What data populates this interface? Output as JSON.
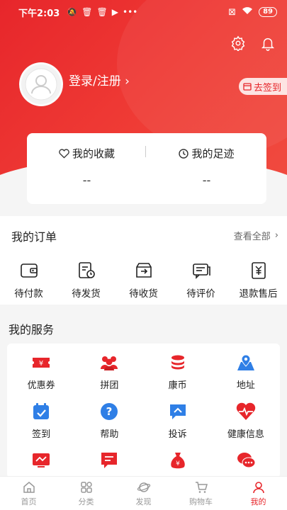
{
  "status": {
    "time": "下午2:03",
    "battery": "89"
  },
  "profile": {
    "login": "登录/注册",
    "checkin": "去签到"
  },
  "card": {
    "favorites": {
      "label": "我的收藏",
      "value": "--"
    },
    "footprints": {
      "label": "我的足迹",
      "value": "--"
    }
  },
  "orders": {
    "title": "我的订单",
    "more": "查看全部",
    "items": [
      {
        "label": "待付款",
        "icon": "wallet-icon"
      },
      {
        "label": "待发货",
        "icon": "clock-doc-icon"
      },
      {
        "label": "待收货",
        "icon": "box-icon"
      },
      {
        "label": "待评价",
        "icon": "comment-icon"
      },
      {
        "label": "退款售后",
        "icon": "refund-icon"
      }
    ]
  },
  "services": {
    "title": "我的服务",
    "items": [
      {
        "label": "优惠券",
        "icon": "coupon-icon"
      },
      {
        "label": "拼团",
        "icon": "group-icon"
      },
      {
        "label": "康币",
        "icon": "coin-stack-icon"
      },
      {
        "label": "地址",
        "icon": "map-pin-icon"
      },
      {
        "label": "签到",
        "icon": "calendar-check-icon"
      },
      {
        "label": "帮助",
        "icon": "help-icon"
      },
      {
        "label": "投诉",
        "icon": "complaint-icon"
      },
      {
        "label": "健康信息",
        "icon": "heart-pulse-icon"
      },
      {
        "label": "",
        "icon": "monitor-icon"
      },
      {
        "label": "",
        "icon": "message-icon"
      },
      {
        "label": "",
        "icon": "money-bag-icon"
      },
      {
        "label": "",
        "icon": "chat-bubbles-icon"
      }
    ]
  },
  "tabbar": [
    {
      "label": "首页"
    },
    {
      "label": "分类"
    },
    {
      "label": "发现"
    },
    {
      "label": "购物车"
    },
    {
      "label": "我的"
    }
  ],
  "colors": {
    "accent": "#e7262b",
    "blue": "#2f7fe6"
  }
}
